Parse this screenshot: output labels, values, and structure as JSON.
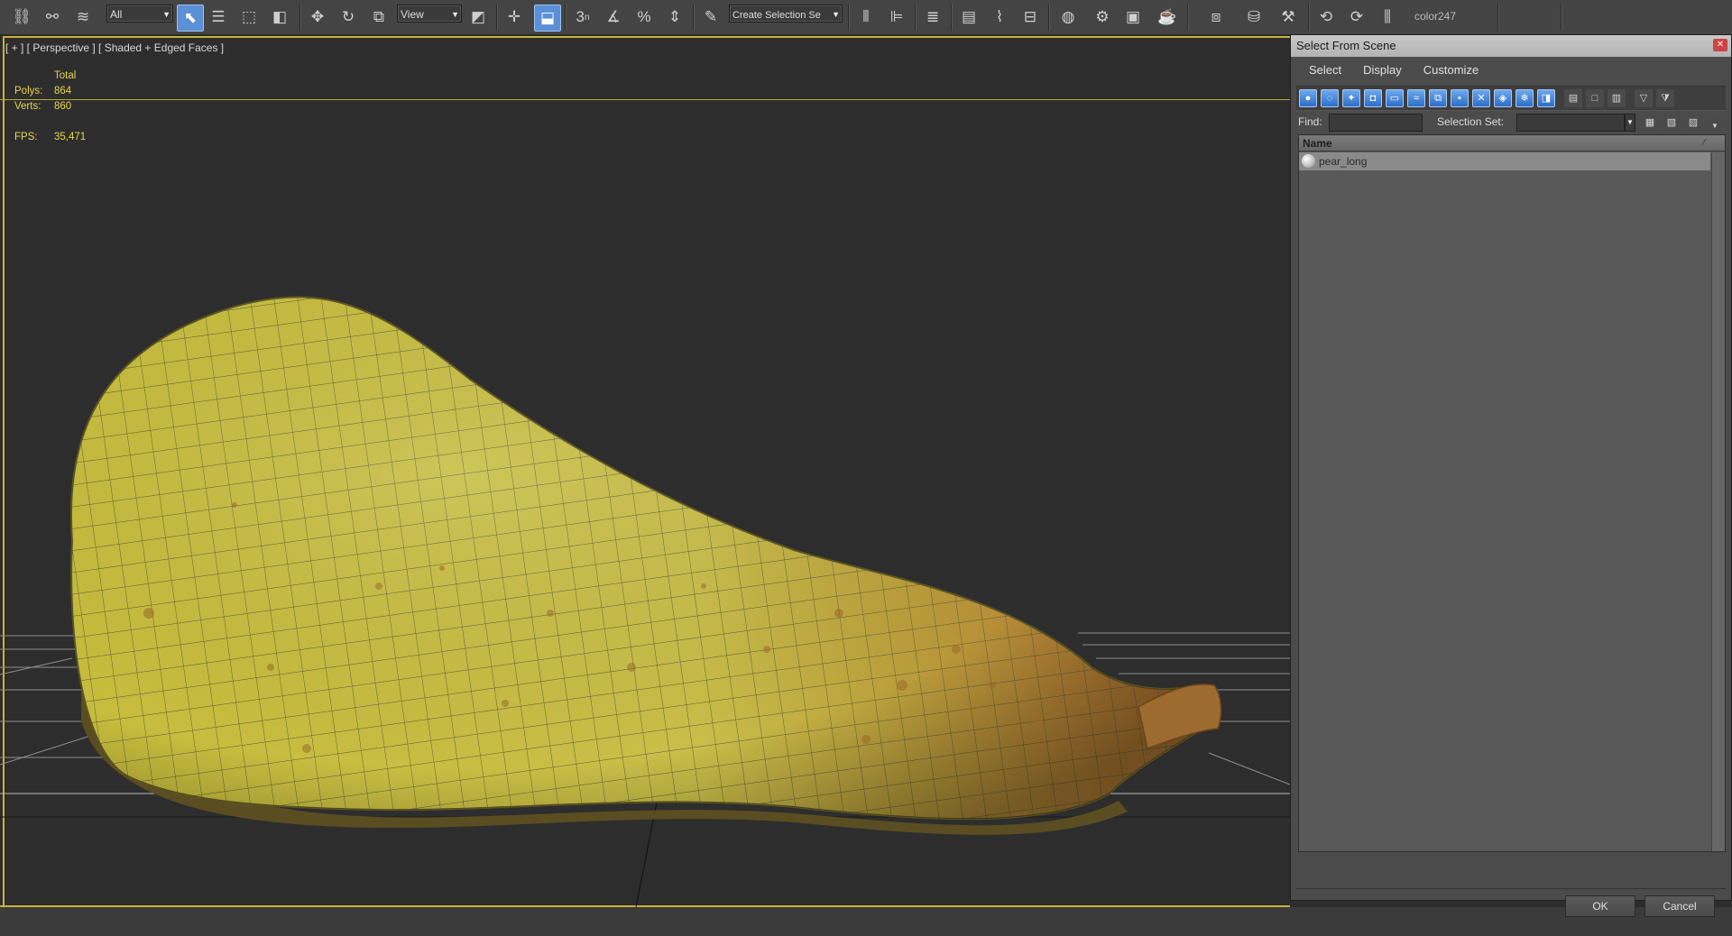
{
  "toolbar": {
    "filter_combo": "All",
    "coord_combo": "View",
    "selection_set_combo": "Create Selection Se",
    "snap_angle_label": "3",
    "layer_label": "color247"
  },
  "viewport": {
    "label": "[ + ] [ Perspective ] [ Shaded + Edged Faces ]",
    "stats": {
      "total_label": "Total",
      "polys_label": "Polys:",
      "polys_value": "864",
      "verts_label": "Verts:",
      "verts_value": "860",
      "fps_label": "FPS:",
      "fps_value": "35,471"
    }
  },
  "dialog": {
    "title": "Select From Scene",
    "menu": [
      "Select",
      "Display",
      "Customize"
    ],
    "find_label": "Find:",
    "find_value": "",
    "selection_set_label": "Selection Set:",
    "selection_set_value": "",
    "list_header": "Name",
    "objects": [
      {
        "name": "pear_long",
        "icon": "geometry-sphere-icon"
      }
    ],
    "ok_label": "OK",
    "cancel_label": "Cancel"
  },
  "colors": {
    "toolbar_bg": "#444444",
    "viewport_bg": "#2d2d2d",
    "viewport_border": "#c9b23a",
    "stats_text": "#e8d64c",
    "accent_blue": "#5b8fd6",
    "pear_yellow": "#c8bf4a",
    "pear_brown": "#b07a2e"
  }
}
